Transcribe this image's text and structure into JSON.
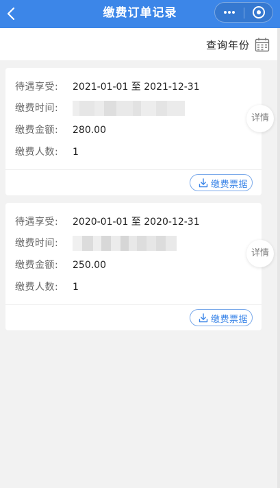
{
  "navbar": {
    "title": "缴费订单记录",
    "back_icon": "chevron-left-icon",
    "more_icon": "more-dots-icon",
    "close_icon": "target-circle-icon",
    "bg_color": "#3c86e8"
  },
  "filter": {
    "label": "查询年份",
    "icon": "calendar-icon"
  },
  "records": [
    {
      "benefit_label": "待遇享受:",
      "benefit_value": "2021-01-01 至 2021-12-31",
      "time_label": "缴费时间:",
      "time_value": "",
      "amount_label": "缴费金额:",
      "amount_value": "280.00",
      "count_label": "缴费人数:",
      "count_value": "1",
      "invoice_label": "缴费票据",
      "detail_label": "详情"
    },
    {
      "benefit_label": "待遇享受:",
      "benefit_value": "2020-01-01 至 2020-12-31",
      "time_label": "缴费时间:",
      "time_value": "",
      "amount_label": "缴费金额:",
      "amount_value": "250.00",
      "count_label": "缴费人数:",
      "count_value": "1",
      "invoice_label": "缴费票据",
      "detail_label": "详情"
    }
  ],
  "colors": {
    "accent": "#3c86e8",
    "background": "#f2f2f2",
    "card": "#ffffff"
  }
}
